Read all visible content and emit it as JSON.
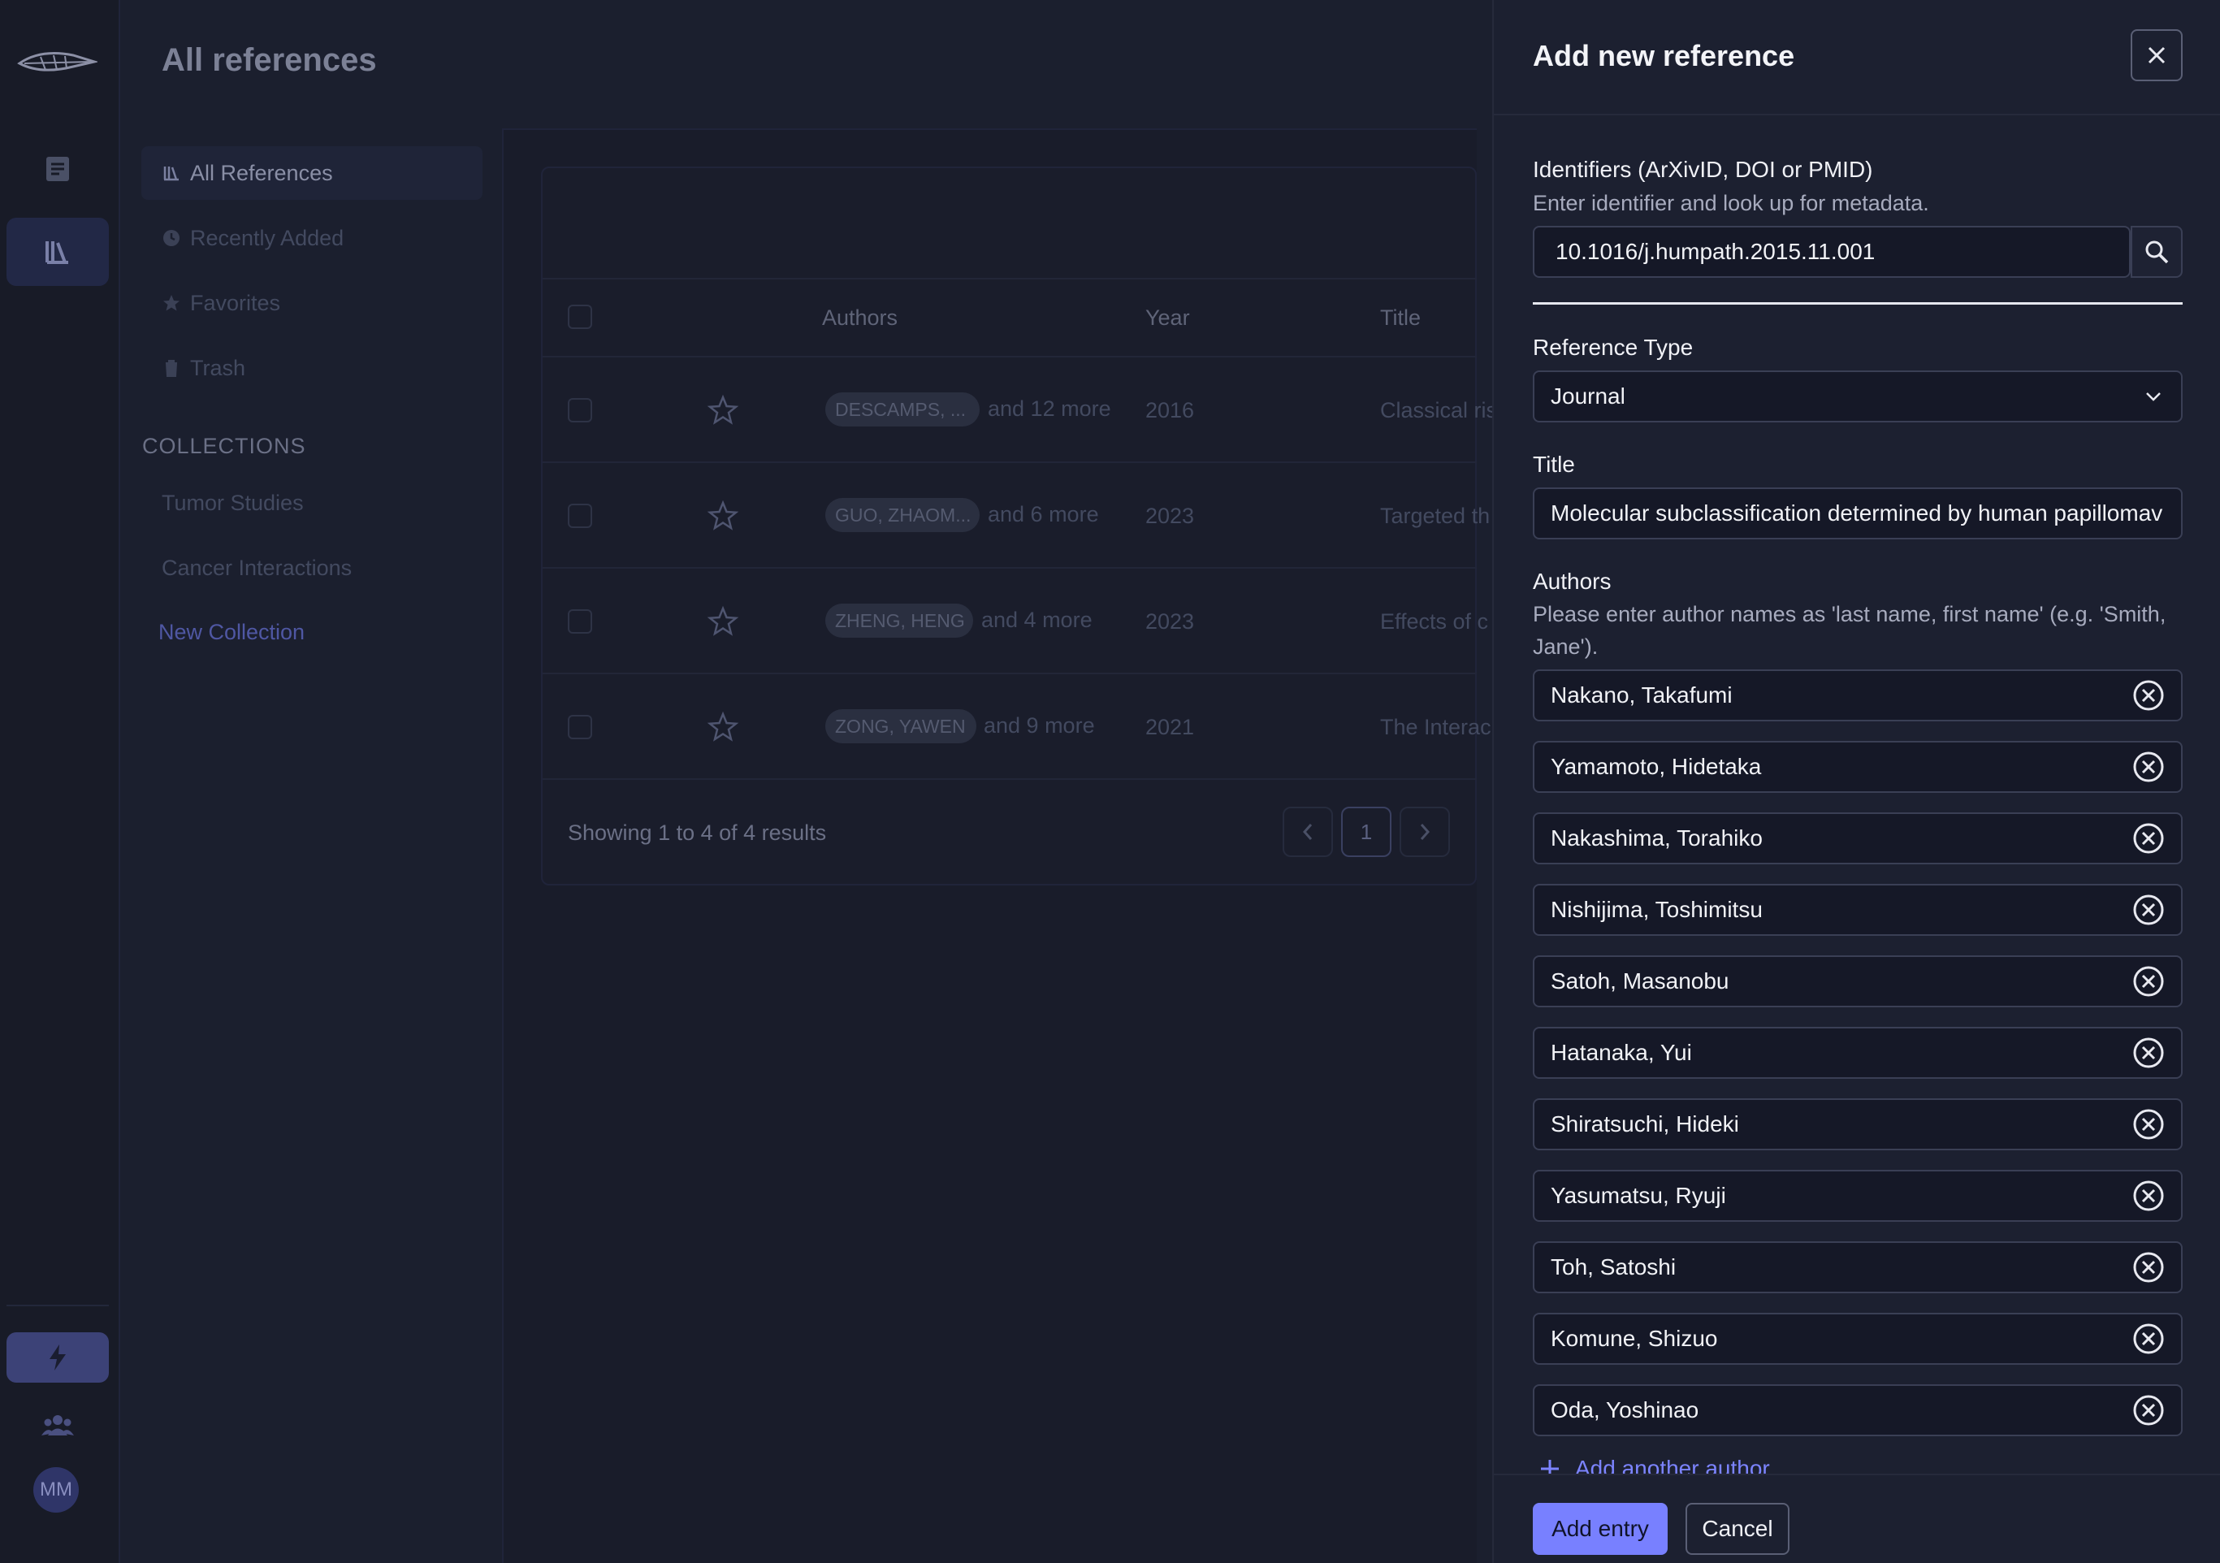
{
  "app": {
    "page_title": "All references",
    "user_initials": "MM"
  },
  "nav": {
    "all_references": "All References",
    "recently_added": "Recently Added",
    "favorites": "Favorites",
    "trash": "Trash",
    "collections_heading": "COLLECTIONS",
    "collections": [
      "Tumor Studies",
      "Cancer Interactions"
    ],
    "new_collection": "New Collection"
  },
  "table": {
    "headers": {
      "authors": "Authors",
      "year": "Year",
      "title": "Title"
    },
    "rows": [
      {
        "author_chip": "DESCAMPS, ...",
        "more": "and 12 more",
        "year": "2016",
        "title": "Classical ris"
      },
      {
        "author_chip": "GUO, ZHAOM...",
        "more": "and 6 more",
        "year": "2023",
        "title": "Targeted th"
      },
      {
        "author_chip": "ZHENG, HENG",
        "more": "and 4 more",
        "year": "2023",
        "title": "Effects of c"
      },
      {
        "author_chip": "ZONG, YAWEN",
        "more": "and 9 more",
        "year": "2021",
        "title": "The Interac"
      }
    ],
    "showing": "Showing 1 to 4 of 4 results",
    "current_page": "1"
  },
  "drawer": {
    "title": "Add new reference",
    "identifiers_label": "Identifiers (ArXivID, DOI or PMID)",
    "identifiers_hint": "Enter identifier and look up for metadata.",
    "identifier_value": "10.1016/j.humpath.2015.11.001",
    "reference_type_label": "Reference Type",
    "reference_type_value": "Journal",
    "title_label": "Title",
    "title_value": "Molecular subclassification determined by human papillomav",
    "authors_label": "Authors",
    "authors_hint": "Please enter author names as 'last name, first name' (e.g. 'Smith, Jane').",
    "authors": [
      "Nakano, Takafumi",
      "Yamamoto, Hidetaka",
      "Nakashima, Torahiko",
      "Nishijima, Toshimitsu",
      "Satoh, Masanobu",
      "Hatanaka, Yui",
      "Shiratsuchi, Hideki",
      "Yasumatsu, Ryuji",
      "Toh, Satoshi",
      "Komune, Shizuo",
      "Oda, Yoshinao"
    ],
    "add_author": "Add another author",
    "add_entry": "Add entry",
    "cancel": "Cancel"
  },
  "colors": {
    "accent": "#7880ff",
    "drawer_bg": "#1c2030",
    "page_bg": "#1b1f2e"
  }
}
